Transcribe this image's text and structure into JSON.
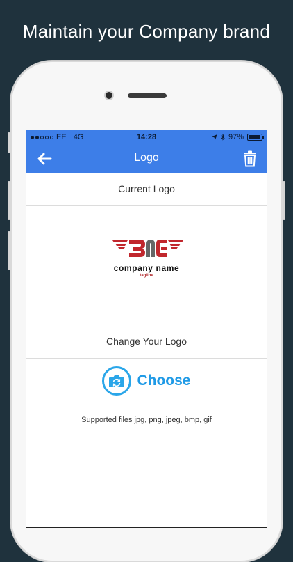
{
  "headline": "Maintain your Company brand",
  "status_bar": {
    "carrier": "EE",
    "network": "4G",
    "time": "14:28",
    "battery": "97%",
    "battery_level": 0.97,
    "icons": [
      "location-arrow-icon",
      "bluetooth-icon",
      "battery-icon"
    ]
  },
  "nav": {
    "title": "Logo",
    "back_icon": "arrow-left-icon",
    "delete_icon": "trash-icon"
  },
  "current_logo": {
    "heading": "Current Logo",
    "logo_name": "company name",
    "logo_tagline": "tagline",
    "colors": {
      "red": "#c1272d",
      "grey": "#666666"
    }
  },
  "change_logo": {
    "heading": "Change Your Logo",
    "choose_label": "Choose",
    "choose_icon": "camera-rotate-icon",
    "supported_text": "Supported files jpg, png, jpeg, bmp, gif"
  },
  "colors": {
    "background": "#1f323d",
    "accent": "#3d7ee8",
    "choose": "#1f9ae6"
  }
}
